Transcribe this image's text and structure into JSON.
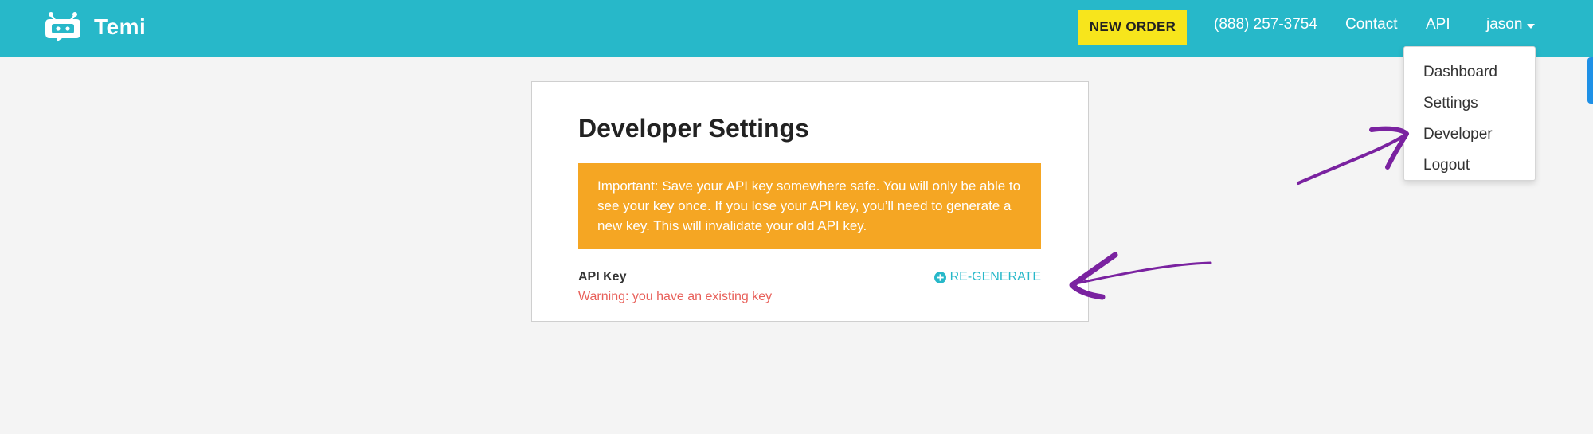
{
  "brand": {
    "name": "Temi"
  },
  "nav": {
    "new_order": "NEW ORDER",
    "phone": "(888) 257-3754",
    "contact": "Contact",
    "api": "API",
    "user": "jason"
  },
  "dropdown": {
    "items": [
      {
        "label": "Dashboard"
      },
      {
        "label": "Settings"
      },
      {
        "label": "Developer"
      },
      {
        "label": "Logout"
      }
    ]
  },
  "card": {
    "title": "Developer Settings",
    "alert": "Important: Save your API key somewhere safe. You will only be able to see your key once. If you lose your API key, you’ll need to generate a new key. This will invalidate your old API key.",
    "api_key_label": "API Key",
    "warning": "Warning: you have an existing key",
    "regenerate": "RE-GENERATE"
  },
  "colors": {
    "navbar": "#27b8c9",
    "new_order_bg": "#f7e51c",
    "alert_bg": "#f5a623",
    "warning_text": "#e8605a",
    "annotation_arrows": "#7a22a0"
  },
  "icons": {
    "brand": "robot-face-icon",
    "caret": "caret-down-icon",
    "regenerate": "plus-circle-icon"
  }
}
